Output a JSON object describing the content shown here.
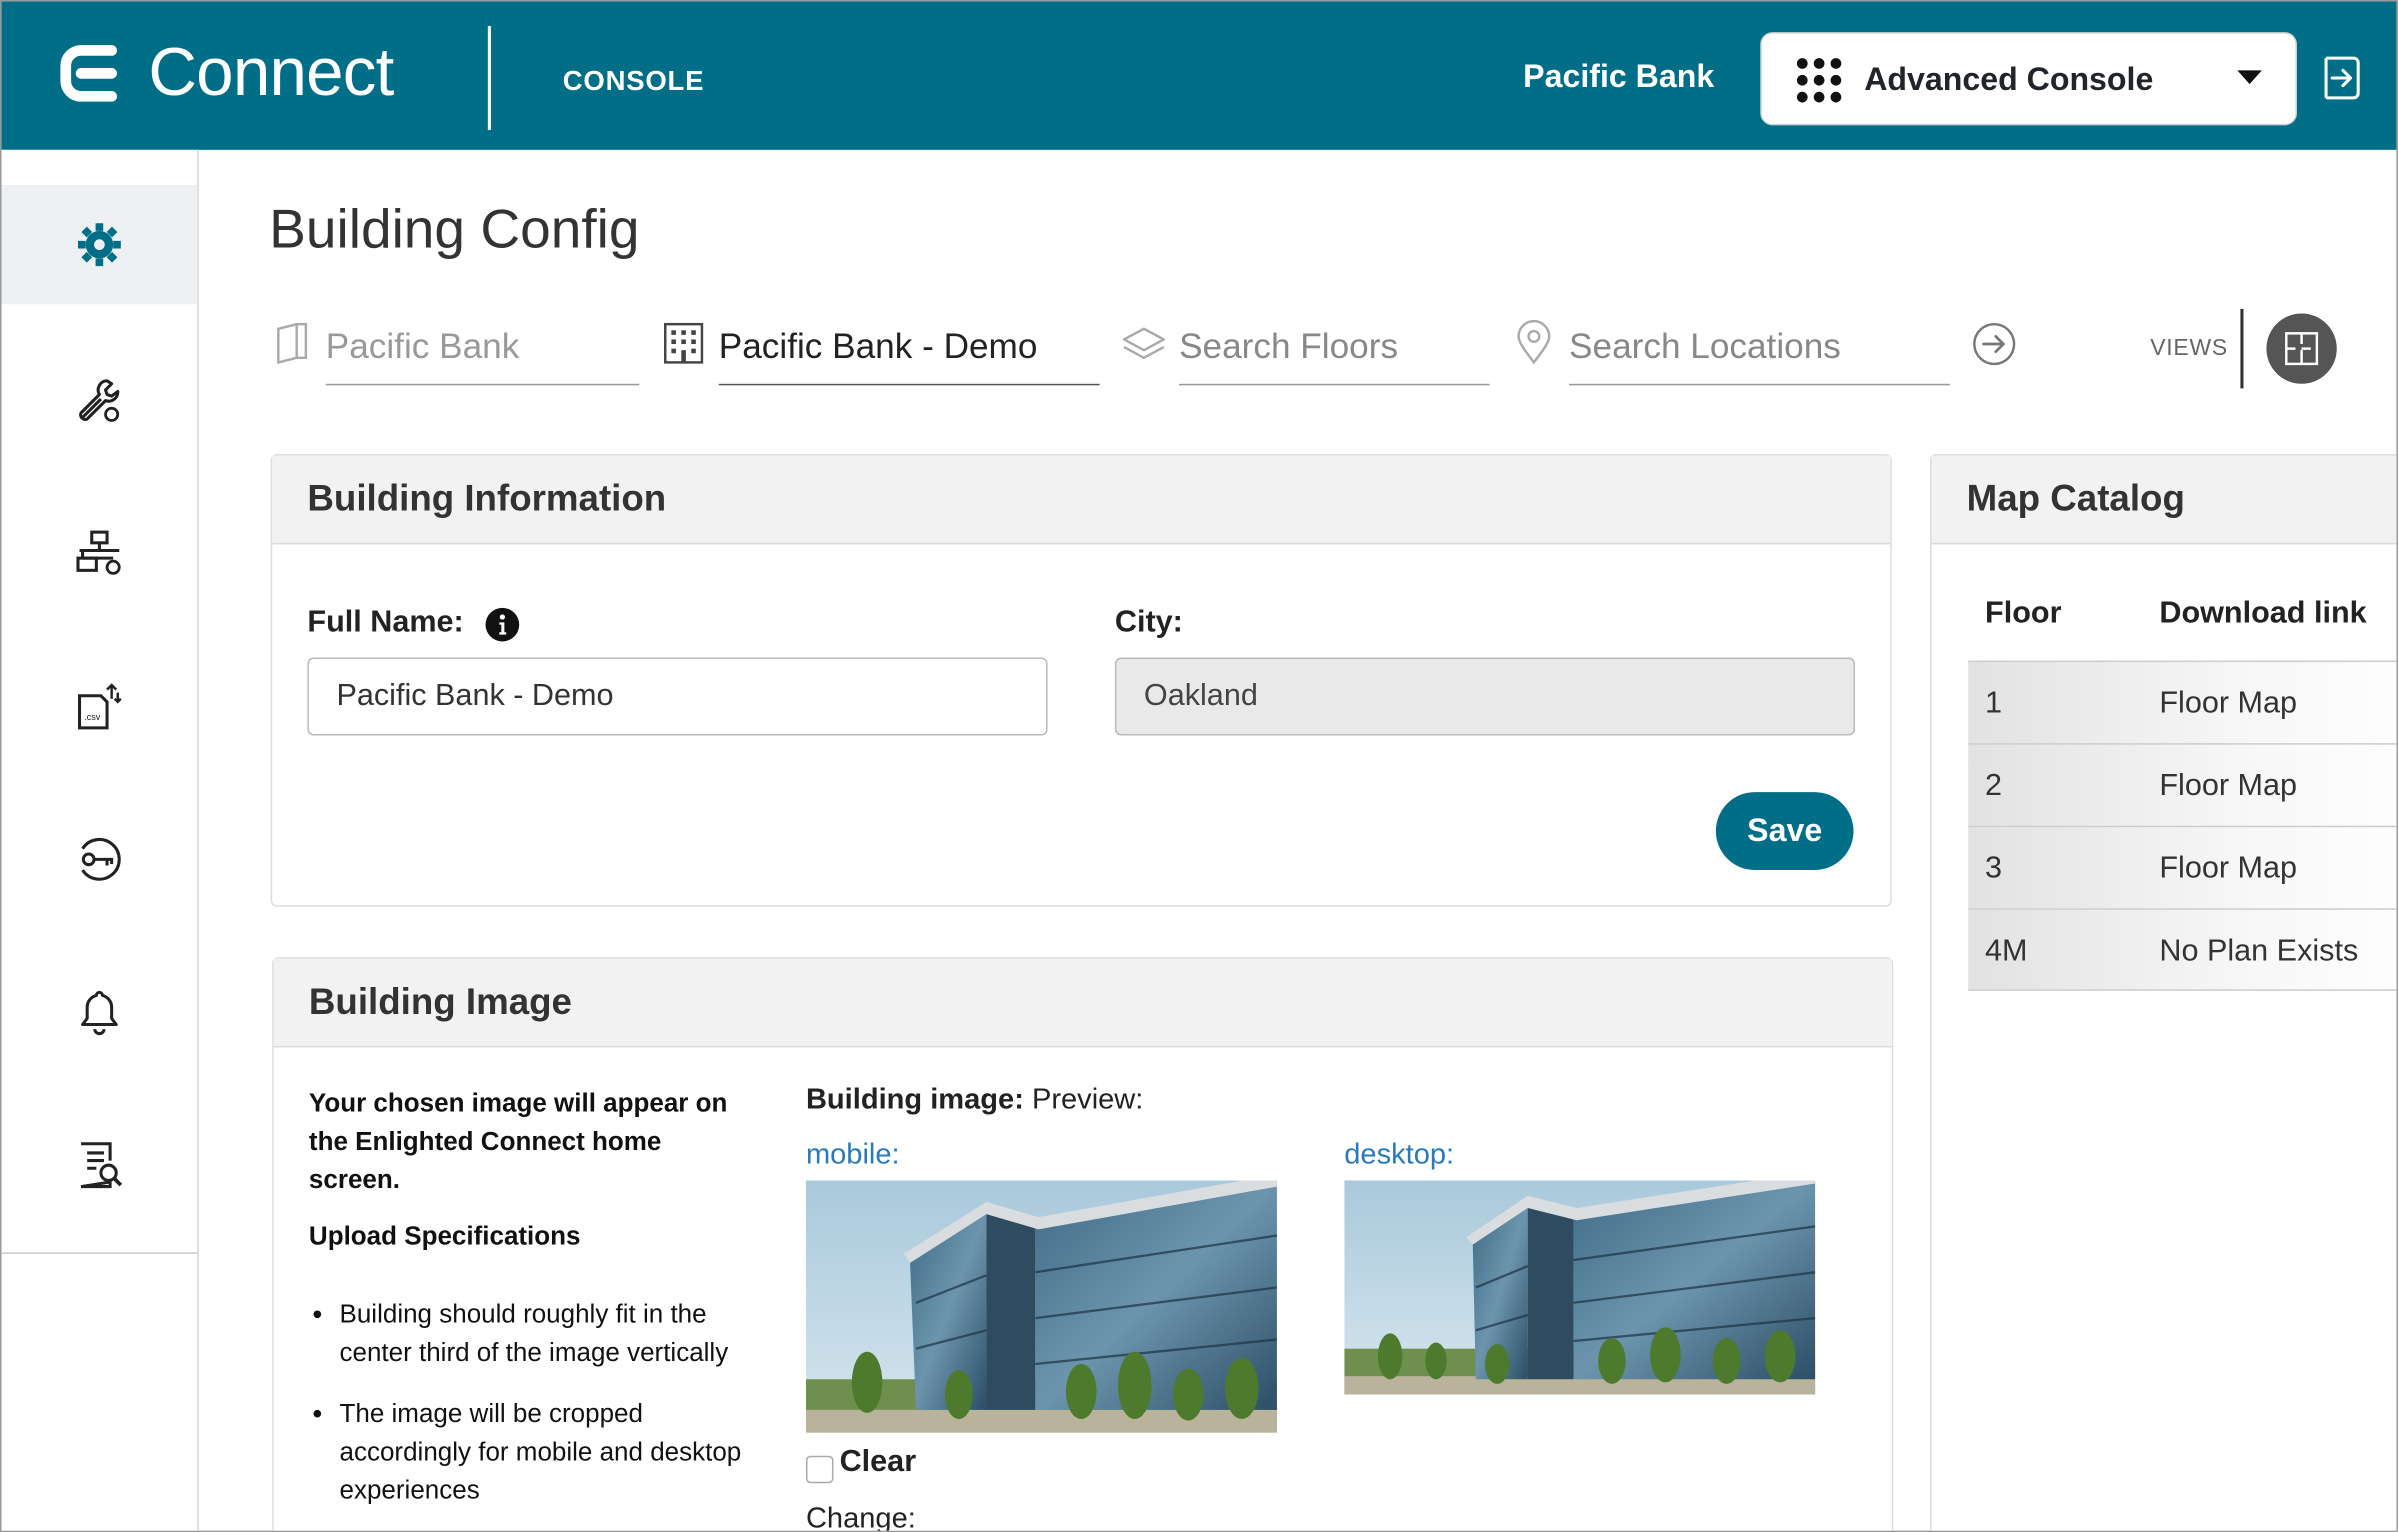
{
  "header": {
    "brand": "Connect",
    "section": "CONSOLE",
    "organization": "Pacific Bank",
    "console_select": "Advanced Console",
    "colors": {
      "primary": "#006e87"
    },
    "icons": [
      "connect-logo-icon",
      "apps-grid-icon",
      "chevron-down-icon",
      "logout-icon"
    ]
  },
  "sidebar": {
    "items": [
      {
        "icon": "gear-icon",
        "active": true
      },
      {
        "icon": "wrench-settings-icon",
        "active": false
      },
      {
        "icon": "network-settings-icon",
        "active": false
      },
      {
        "icon": "csv-upload-icon",
        "active": false
      },
      {
        "icon": "key-icon",
        "active": false
      },
      {
        "icon": "bell-icon",
        "active": false
      },
      {
        "icon": "report-search-icon",
        "active": false
      }
    ]
  },
  "page": {
    "title": "Building Config"
  },
  "nav": {
    "org": "Pacific Bank",
    "building": "Pacific Bank - Demo",
    "floors_placeholder": "Search Floors",
    "locations_placeholder": "Search Locations",
    "views_label": "VIEWS"
  },
  "building_info": {
    "title": "Building Information",
    "full_name_label": "Full Name:",
    "full_name_value": "Pacific Bank - Demo",
    "city_label": "City:",
    "city_value": "Oakland",
    "save_label": "Save"
  },
  "building_image": {
    "title": "Building Image",
    "description": "Your chosen image will appear on the Enlighted Connect home screen.",
    "spec_title": "Upload Specifications",
    "specs": [
      "Building should roughly fit in the center third of the image vertically",
      "The image will be cropped accordingly for mobile and desktop experiences"
    ],
    "preview_bold": "Building image:",
    "preview_text": "Preview:",
    "mobile_label": "mobile:",
    "desktop_label": "desktop:",
    "clear_label": "Clear",
    "change_label": "Change:"
  },
  "map_catalog": {
    "title": "Map Catalog",
    "columns": [
      "Floor",
      "Download link"
    ],
    "rows": [
      {
        "floor": "1",
        "link": "Floor Map"
      },
      {
        "floor": "2",
        "link": "Floor Map"
      },
      {
        "floor": "3",
        "link": "Floor Map"
      },
      {
        "floor": "4M",
        "link": "No Plan Exists"
      }
    ]
  }
}
